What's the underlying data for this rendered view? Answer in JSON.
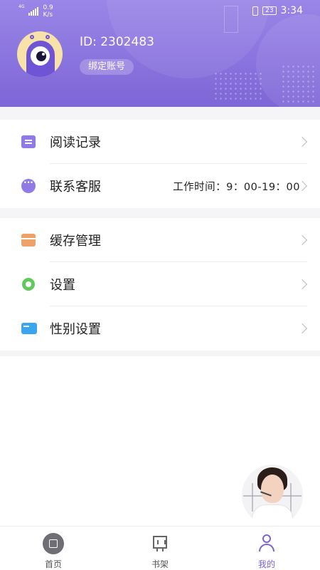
{
  "status_bar": {
    "network": "4G",
    "speed_value": "0.9",
    "speed_unit": "K/s",
    "battery": "23",
    "time": "3:34"
  },
  "profile": {
    "user_id": "ID: 2302483",
    "bind_label": "绑定账号"
  },
  "menu": {
    "group1": [
      {
        "label": "阅读记录",
        "icon": "reading-record-icon",
        "extra": ""
      },
      {
        "label": "联系客服",
        "icon": "chat-bubble-icon",
        "extra": "工作时间：9：00-19：00"
      }
    ],
    "group2": [
      {
        "label": "缓存管理",
        "icon": "cache-box-icon"
      },
      {
        "label": "设置",
        "icon": "gear-icon"
      },
      {
        "label": "性别设置",
        "icon": "gender-card-icon"
      }
    ]
  },
  "tabbar": {
    "tabs": [
      {
        "label": "首页",
        "icon": "home-icon",
        "active": false
      },
      {
        "label": "书架",
        "icon": "bookshelf-icon",
        "active": false
      },
      {
        "label": "我的",
        "icon": "user-icon",
        "active": true
      }
    ]
  },
  "colors": {
    "header_gradient_top": "#9a86e8",
    "header_gradient_bottom": "#7d66d6",
    "accent": "#7a63d6",
    "page_gap": "#f5f5f8"
  }
}
